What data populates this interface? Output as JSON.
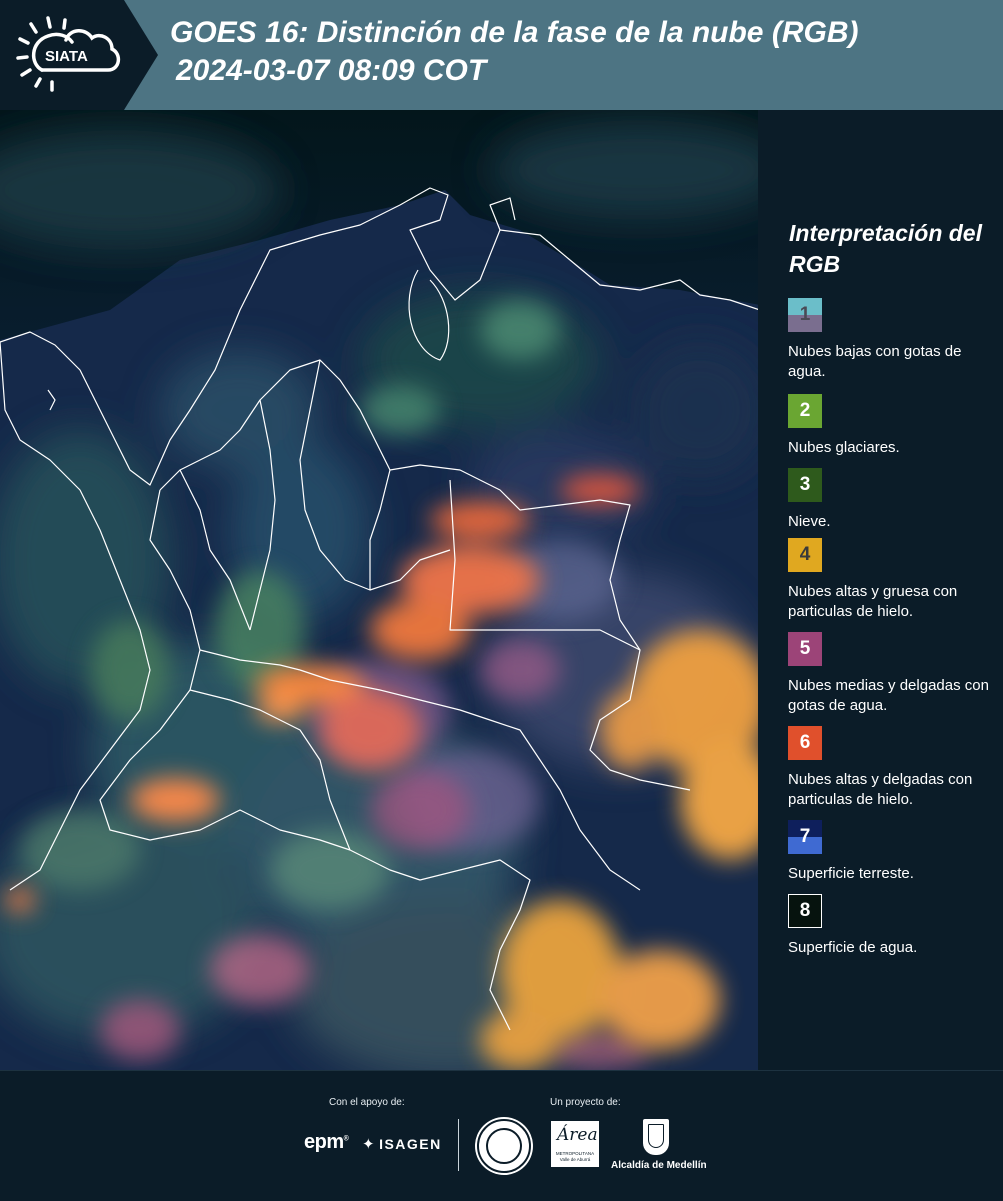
{
  "header": {
    "logo_text": "SIATA",
    "title_line1": "GOES 16: Distinción de la fase de la nube (RGB)",
    "title_line2": "2024-03-07 08:09 COT"
  },
  "map": {
    "imagery": "GOES-16 cloud phase distinction RGB over Colombia",
    "border_color": "#ffffff",
    "ocean_color": "#02141a"
  },
  "legend": {
    "title": "Interpretación del RGB",
    "items": [
      {
        "number": "1",
        "label": "Nubes bajas con gotas de agua.",
        "color_top": "#6bbec9",
        "color_bottom": "#7a6e8f",
        "number_color": "#4a4a55"
      },
      {
        "number": "2",
        "label": "Nubes glaciares.",
        "color": "#6aa632",
        "number_color": "#ffffff"
      },
      {
        "number": "3",
        "label": "Nieve.",
        "color": "#2e5a1c",
        "number_color": "#ffffff"
      },
      {
        "number": "4",
        "label": "Nubes altas y gruesa con particulas de hielo.",
        "color": "#e0a820",
        "number_color": "#3a3a3a"
      },
      {
        "number": "5",
        "label": "Nubes medias y delgadas con gotas de agua.",
        "color": "#9c4478",
        "number_color": "#ffffff"
      },
      {
        "number": "6",
        "label": "Nubes altas y delgadas con particulas de hielo.",
        "color": "#e0502c",
        "number_color": "#ffffff"
      },
      {
        "number": "7",
        "label": "Superficie terreste.",
        "color_top": "#0e1f5c",
        "color_bottom": "#3f6ad2",
        "number_color": "#ffffff"
      },
      {
        "number": "8",
        "label": "Superficie de agua.",
        "color": "#06130e",
        "number_color": "#ffffff",
        "border": "#ffffff"
      }
    ]
  },
  "footer": {
    "support_label": "Con el apoyo de:",
    "project_label": "Un proyecto de:",
    "epm": "epm",
    "isagen": "ISAGEN",
    "area_script": "Área",
    "area_sub": "METROPOLITANA Valle de Aburrá",
    "medellin": "Alcaldía de Medellín"
  }
}
